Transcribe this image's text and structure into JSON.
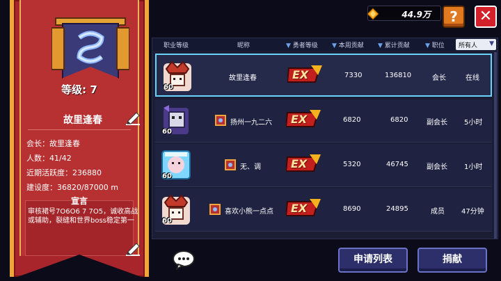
{
  "guild": {
    "level_text": "等级: 7",
    "name": "故里逢春",
    "leader_line": "会长：故里逢春",
    "members_line": "人数：41/42",
    "activity_line": "近期活跃度：236880",
    "construction_line": "建设度：36820/87000 m",
    "manifesto_title": "宣言",
    "manifesto_text": "审核裙号7O6O6 7 7O5，诚收高战或辅助，裂缝和世界boss稳定第一"
  },
  "topbar": {
    "currency_value": "44.9万",
    "help_label": "?",
    "close_label": "✕"
  },
  "table": {
    "headers": {
      "job_level": "职业等级",
      "nickname": "昵称",
      "hero_level": "勇者等级",
      "week_contrib": "本周贡献",
      "total_contrib": "累计贡献",
      "position": "职位"
    },
    "filter_label": "所有人",
    "rows": [
      {
        "level": "60",
        "name": "故里逢春",
        "badge": "EX",
        "week": "7330",
        "total": "136810",
        "role": "会长",
        "status": "在线"
      },
      {
        "level": "60",
        "name": "扬州一九二六",
        "badge": "EX",
        "week": "6820",
        "total": "6820",
        "role": "副会长",
        "status": "5小时"
      },
      {
        "level": "60",
        "name": "无、调",
        "badge": "EX",
        "week": "5320",
        "total": "46745",
        "role": "副会长",
        "status": "1小时"
      },
      {
        "level": "60",
        "name": "喜欢小熊一点点",
        "badge": "EX",
        "week": "8690",
        "total": "24895",
        "role": "成员",
        "status": "47分钟"
      }
    ]
  },
  "bottom": {
    "apply_list_label": "申请列表",
    "donate_label": "捐献"
  },
  "colors": {
    "banner_red": "#a8262b",
    "banner_gold": "#f0a63a",
    "selected_outline": "#6ad3ff",
    "button_blue": "#2c2f6a"
  }
}
